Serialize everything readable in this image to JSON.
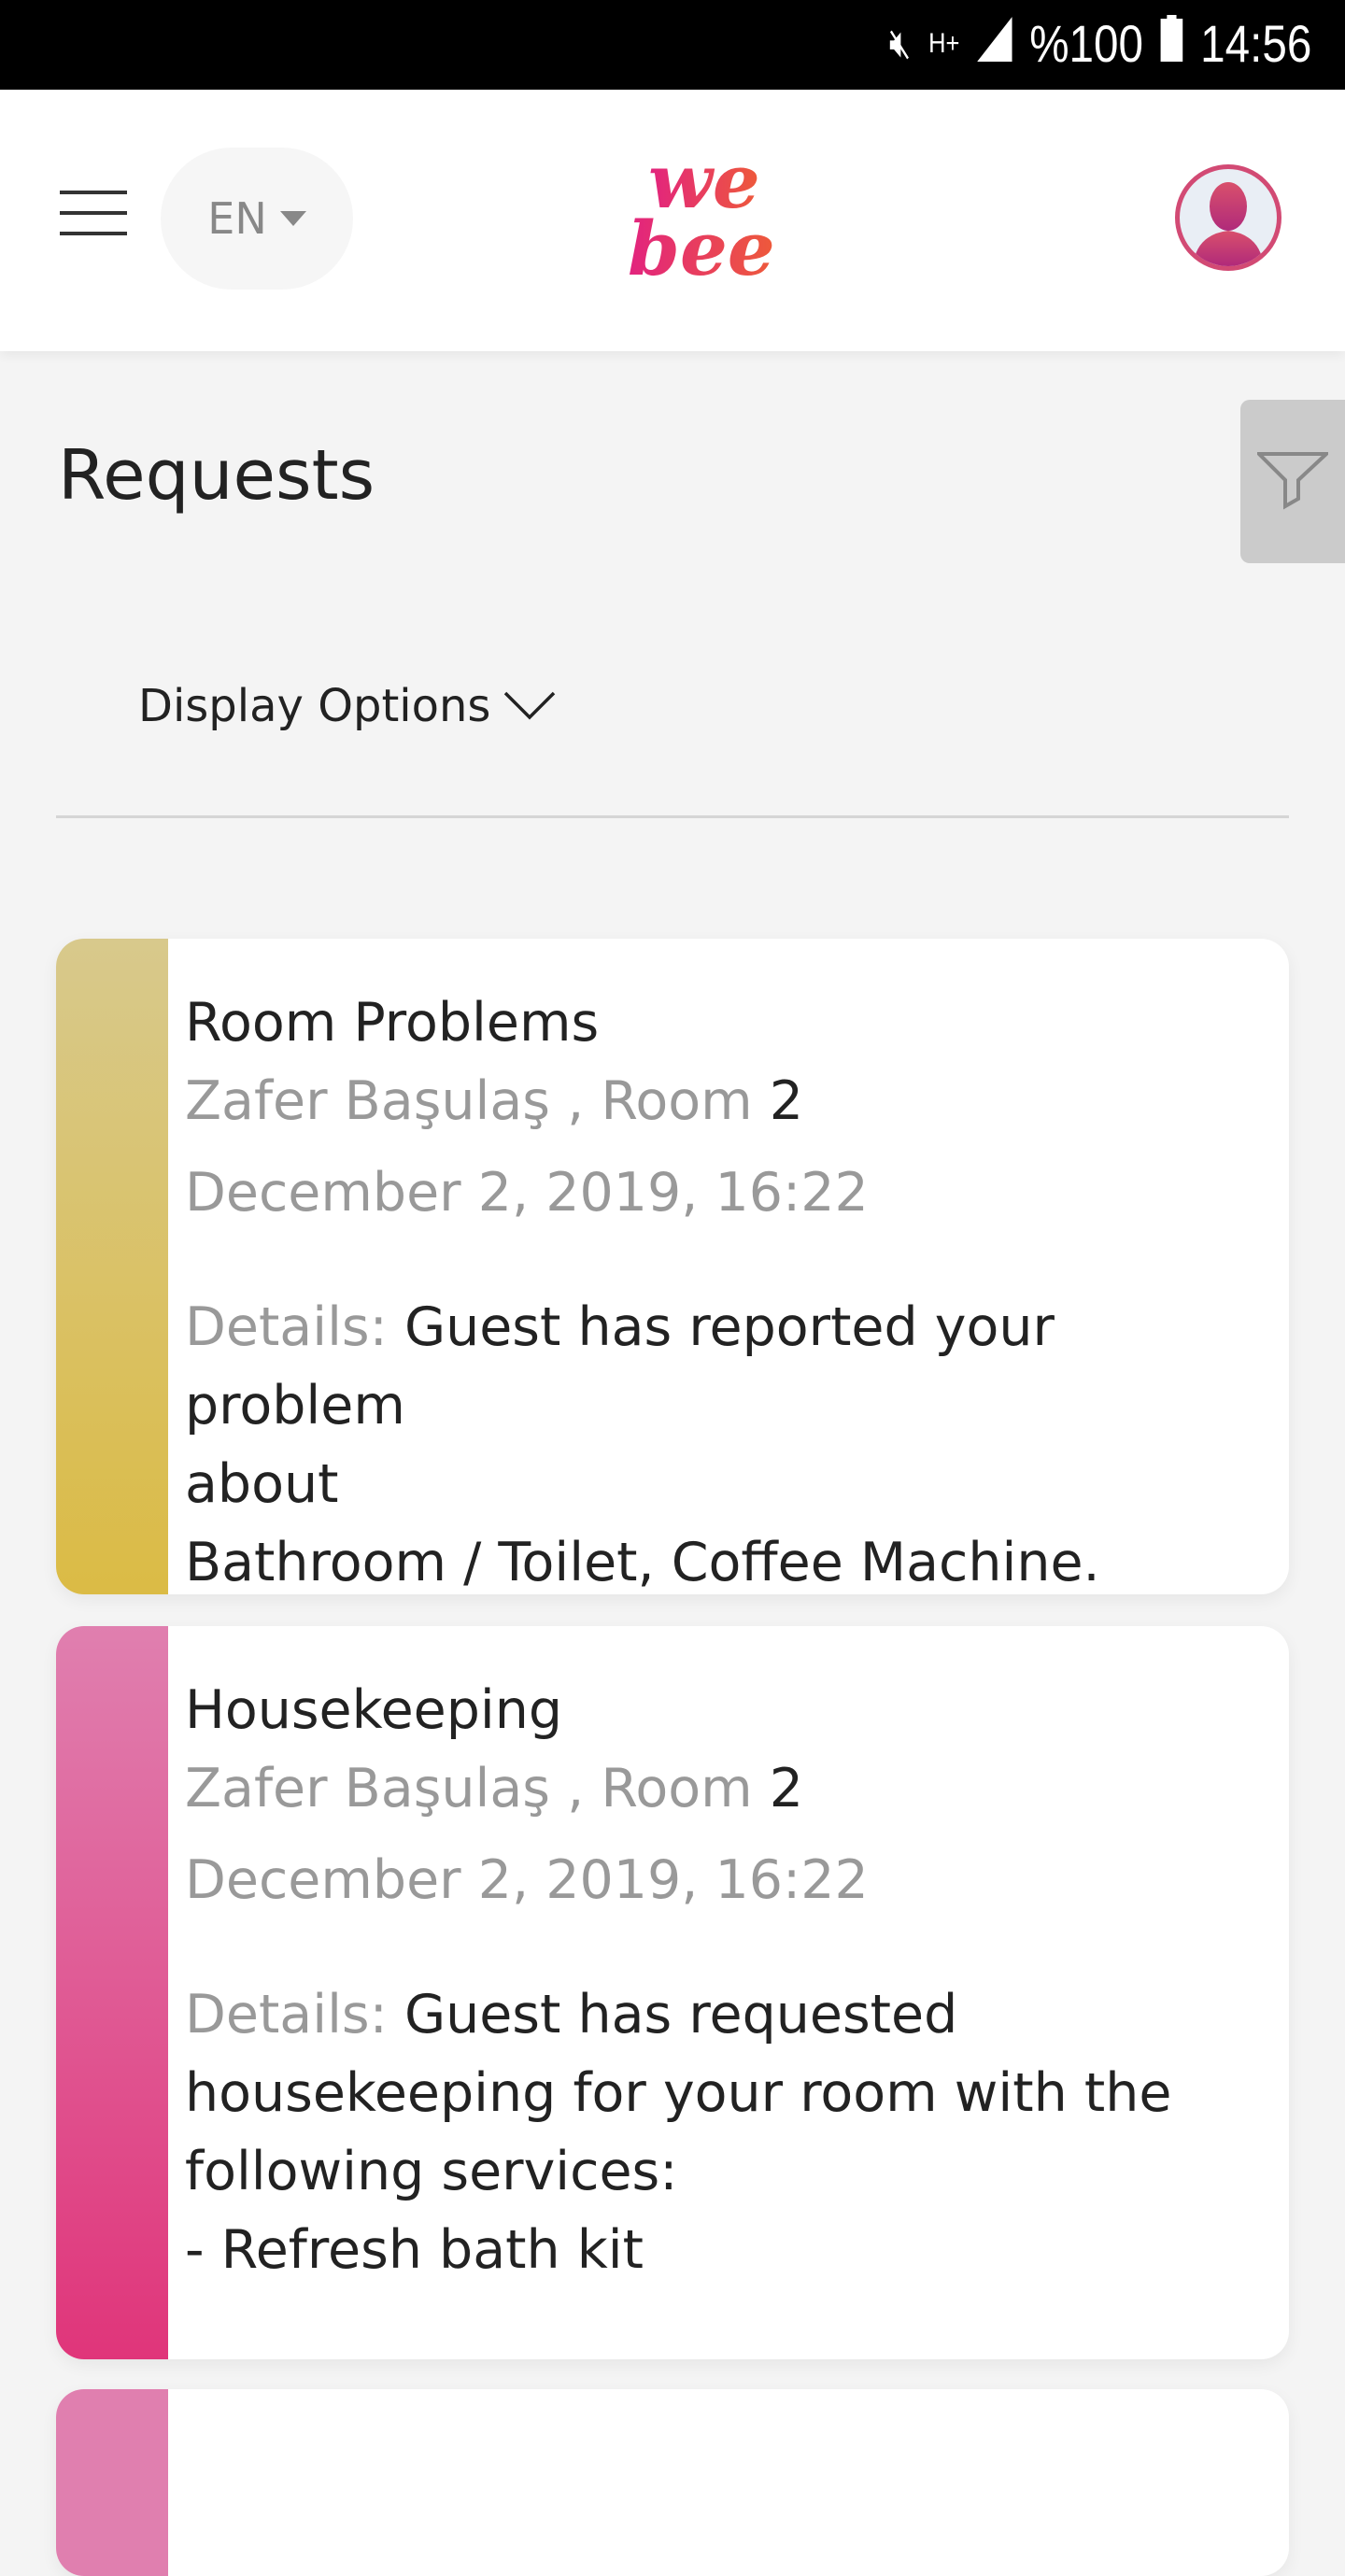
{
  "status_bar": {
    "icons": [
      "mute-icon",
      "h-plus-data-icon",
      "signal-icon",
      "battery-icon"
    ],
    "network": "H+",
    "battery": "%100",
    "time": "14:56"
  },
  "header": {
    "language": "EN",
    "logo_text": "we bee"
  },
  "page": {
    "title": "Requests",
    "display_options": "Display Options"
  },
  "requests": [
    {
      "category": "Room Problems",
      "color_top": "#d8c98c",
      "color_bottom": "#dbbb45",
      "guest": "Zafer Başulaş",
      "room_label": ", Room",
      "room": "2",
      "date": "December 2, 2019, 16:22",
      "details_label": "Details:",
      "details_lines": [
        "Guest has reported your problem",
        "about",
        "Bathroom / Toilet, Coffee Machine."
      ]
    },
    {
      "category": "Housekeeping",
      "color_top": "#e07faf",
      "color_bottom": "#e0357a",
      "guest": "Zafer Başulaş",
      "room_label": ", Room",
      "room": "2",
      "date": "December 2, 2019, 16:22",
      "details_label": "Details:",
      "details_lines": [
        "Guest has requested",
        "housekeeping for your room with the",
        "following services:",
        "- Refresh bath kit"
      ]
    }
  ]
}
